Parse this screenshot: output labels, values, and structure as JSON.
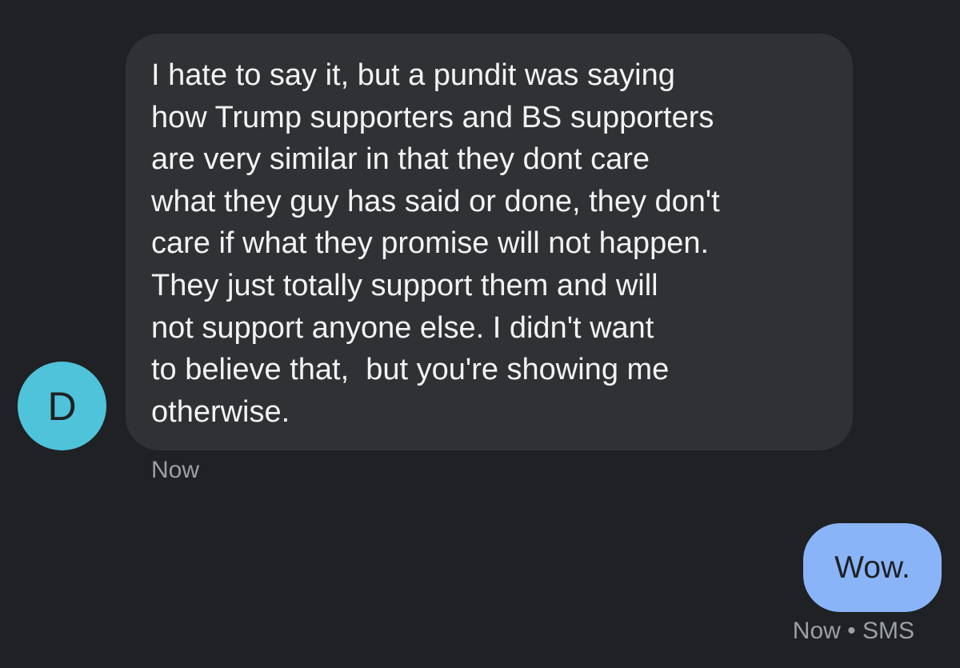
{
  "app": {
    "screen": "sms-conversation"
  },
  "colors": {
    "background": "#202124",
    "incoming_bubble": "#303134",
    "incoming_text": "#f1f3f4",
    "meta_text": "#9aa0a6",
    "avatar": "#4fc3d9",
    "outgoing_bubble": "#8ab4f8",
    "outgoing_text": "#202124"
  },
  "conversation": {
    "contact_avatar": {
      "initial": "D",
      "shape": "circle"
    },
    "incoming_message": {
      "lines": [
        "I hate to say it, but a pundit was saying",
        "how Trump supporters and BS supporters",
        "are very similar in that they dont care",
        "what they guy has said or done, they don't",
        "care if what they promise will not happen.",
        "They just totally support them and will",
        "not support anyone else. I didn't want",
        "to believe that,  but you're showing me",
        "otherwise."
      ],
      "timestamp": "Now"
    },
    "outgoing_message": {
      "text": "Wow.",
      "status": "Now • SMS"
    }
  }
}
